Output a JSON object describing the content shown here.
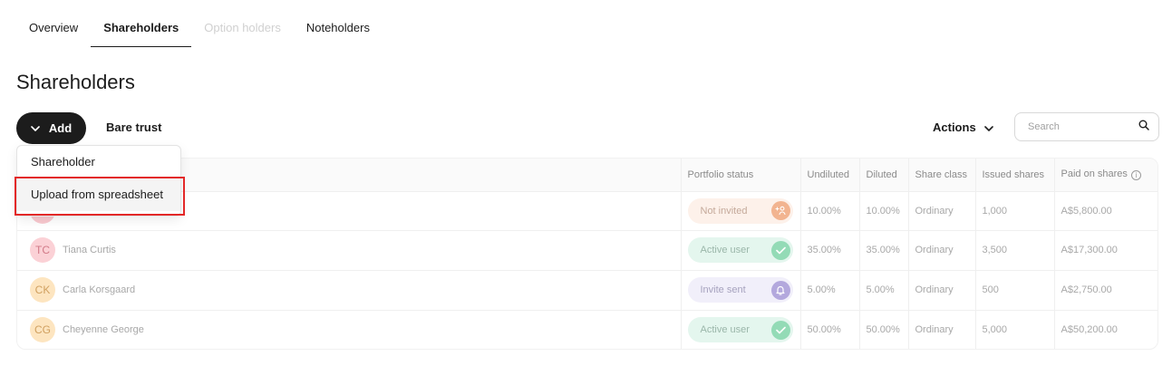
{
  "tabs": [
    {
      "label": "Overview",
      "state": "normal"
    },
    {
      "label": "Shareholders",
      "state": "active"
    },
    {
      "label": "Option holders",
      "state": "disabled"
    },
    {
      "label": "Noteholders",
      "state": "normal"
    }
  ],
  "page_title": "Shareholders",
  "toolbar": {
    "add_label": "Add",
    "bare_trust_label": "Bare trust",
    "actions_label": "Actions",
    "search_placeholder": "Search"
  },
  "add_menu": {
    "items": [
      {
        "label": "Shareholder"
      },
      {
        "label": "Upload from spreadsheet"
      }
    ],
    "highlighted_index": 1
  },
  "table": {
    "headers": {
      "status": "Portfolio status",
      "undiluted": "Undiluted",
      "diluted": "Diluted",
      "share_class": "Share class",
      "issued": "Issued shares",
      "paid": "Paid on shares"
    },
    "rows": [
      {
        "initials": "",
        "name": "",
        "avatar_bg": "#f9c9cf",
        "avatar_fg": "#d66f7f",
        "status": "Not invited",
        "status_bg": "#fdf1ea",
        "status_fg": "#c4a99a",
        "status_icon": "add-user-icon",
        "status_icon_bg": "#f2b490",
        "undiluted": "10.00%",
        "diluted": "10.00%",
        "share_class": "Ordinary",
        "issued": "1,000",
        "paid": "A$5,800.00"
      },
      {
        "initials": "TC",
        "name": "Tiana Curtis",
        "avatar_bg": "#fbd1d6",
        "avatar_fg": "#d27a88",
        "status": "Active user",
        "status_bg": "#e4f6ee",
        "status_fg": "#9ab6a9",
        "status_icon": "check-icon",
        "status_icon_bg": "#93dbb6",
        "undiluted": "35.00%",
        "diluted": "35.00%",
        "share_class": "Ordinary",
        "issued": "3,500",
        "paid": "A$17,300.00"
      },
      {
        "initials": "CK",
        "name": "Carla Korsgaard",
        "avatar_bg": "#fde5c0",
        "avatar_fg": "#d0a060",
        "status": "Invite sent",
        "status_bg": "#f1effa",
        "status_fg": "#a6a2be",
        "status_icon": "bell-icon",
        "status_icon_bg": "#b3a8dd",
        "undiluted": "5.00%",
        "diluted": "5.00%",
        "share_class": "Ordinary",
        "issued": "500",
        "paid": "A$2,750.00"
      },
      {
        "initials": "CG",
        "name": "Cheyenne George",
        "avatar_bg": "#fde5c0",
        "avatar_fg": "#d0a060",
        "status": "Active user",
        "status_bg": "#e4f6ee",
        "status_fg": "#9ab6a9",
        "status_icon": "check-icon",
        "status_icon_bg": "#93dbb6",
        "undiluted": "50.00%",
        "diluted": "50.00%",
        "share_class": "Ordinary",
        "issued": "5,000",
        "paid": "A$50,200.00"
      }
    ]
  },
  "colors": {
    "primary_dark": "#1c1c1c",
    "highlight_box": "#e32828"
  }
}
